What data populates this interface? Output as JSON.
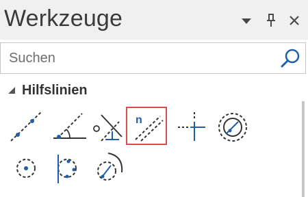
{
  "panel": {
    "title": "Werkzeuge",
    "buttons": [
      "dropdown-icon",
      "pin-icon",
      "close-icon"
    ]
  },
  "search": {
    "placeholder": "Suchen"
  },
  "section": {
    "title": "Hilfslinien",
    "expanded": true
  },
  "tools": [
    {
      "icon": "dashed-line-two-points-icon"
    },
    {
      "icon": "dashed-line-angle-icon"
    },
    {
      "icon": "dashed-line-perpendicular-icon"
    },
    {
      "icon": "parallel-guideline-icon",
      "badge": "n",
      "selected": true
    },
    {
      "icon": "crosshair-guidelines-icon"
    },
    {
      "icon": "circle-guideline-icon"
    },
    {
      "icon": "dashed-circle-center-icon"
    },
    {
      "icon": "dashed-circle-tangent-line-icon"
    },
    {
      "icon": "dashed-circle-arc-icon"
    }
  ],
  "colors": {
    "accent": "#1f5fa8",
    "selection": "#e04b4b",
    "icon_dark": "#333333"
  }
}
